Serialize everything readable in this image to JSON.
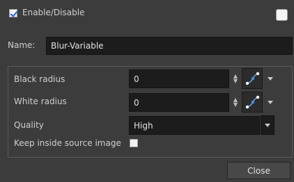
{
  "header": {
    "enable_label": "Enable/Disable",
    "enable_checked": true
  },
  "name_row": {
    "label": "Name:",
    "value": "Blur-Variable"
  },
  "params": {
    "black_radius": {
      "label": "Black radius",
      "value": "0"
    },
    "white_radius": {
      "label": "White radius",
      "value": "0"
    },
    "quality": {
      "label": "Quality",
      "value": "High"
    },
    "keep_inside": {
      "label": "Keep inside source image",
      "checked": false
    }
  },
  "footer": {
    "close_label": "Close"
  },
  "icons": {
    "function_curve": "function-curve-icon",
    "spinner": "spinner-icon",
    "dropdown": "chevron-down-icon"
  }
}
